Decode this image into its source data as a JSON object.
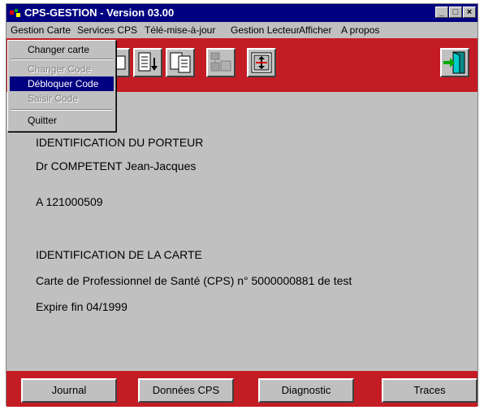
{
  "window": {
    "title": "CPS-GESTION - Version 03.00",
    "controls": [
      "_",
      "□",
      "×"
    ]
  },
  "menubar": {
    "items": [
      "Gestion Carte",
      "Services CPS",
      "Télé-mise-à-jour",
      "Gestion Lecteur",
      "Afficher",
      "A propos"
    ]
  },
  "dropdown": {
    "items": [
      {
        "label": "Changer carte",
        "enabled": true
      },
      {
        "label": "Changer Code",
        "enabled": false
      },
      {
        "label": "Débloquer Code",
        "enabled": true,
        "selected": true
      },
      {
        "label": "Saisir Code",
        "enabled": false
      },
      {
        "label": "Quitter",
        "enabled": true
      }
    ]
  },
  "toolbar": {
    "icons": [
      "card-icon",
      "list-download-icon",
      "list-copy-icon",
      "card-reader-icon",
      "sync-icon",
      "exit-door-icon"
    ]
  },
  "content": {
    "porteur_heading": "IDENTIFICATION DU PORTEUR",
    "porteur_name": "Dr COMPETENT Jean-Jacques",
    "porteur_id": "A 121000509",
    "carte_heading": "IDENTIFICATION DE LA CARTE",
    "carte_desc": "Carte de Professionnel de Santé (CPS) n° 5000000881 de test",
    "carte_expiry": "Expire fin 04/1999"
  },
  "footer": {
    "buttons": [
      "Journal",
      "Données CPS",
      "Diagnostic",
      "Traces"
    ]
  },
  "colors": {
    "title_bar": "#000080",
    "red_panel": "#c41c24",
    "face": "#c0c0c0"
  }
}
